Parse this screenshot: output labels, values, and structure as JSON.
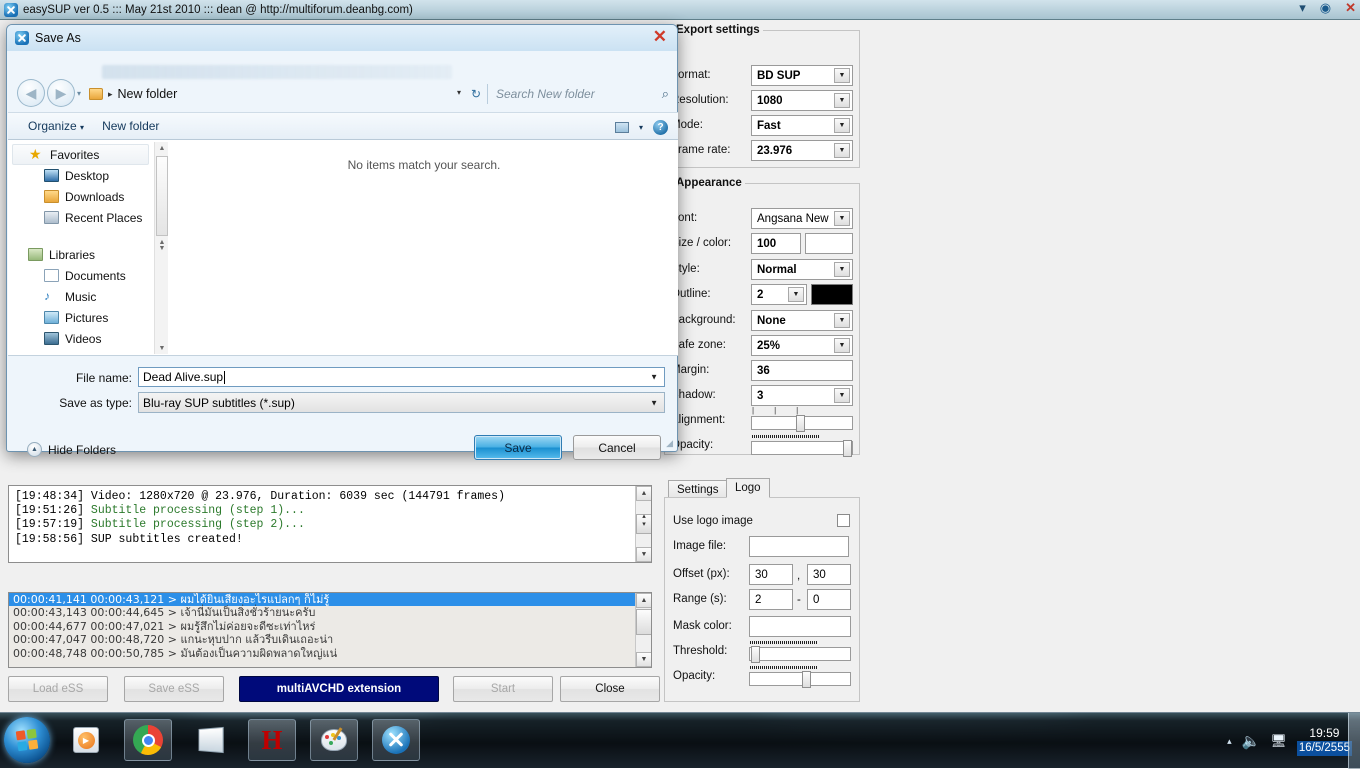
{
  "app": {
    "title": "easySUP ver 0.5 ::: May 21st 2010 ::: dean @ http://multiforum.deanbg.com)",
    "sysicon": "easysup-icon",
    "minimize": "▾",
    "maximize": "◉",
    "close": "✕"
  },
  "export_settings": {
    "group_title": "Export settings",
    "rows": [
      {
        "label": "Format:",
        "value": "BD SUP"
      },
      {
        "label": "Resolution:",
        "value": "1080"
      },
      {
        "label": "Mode:",
        "value": "Fast"
      },
      {
        "label": "Frame rate:",
        "value": "23.976"
      }
    ]
  },
  "appearance": {
    "group_title": "Appearance",
    "font_label": "Font:",
    "font_value": "Angsana New",
    "size_color_label": "Size / color:",
    "size_value": "100",
    "color_value": "",
    "style_label": "Style:",
    "style_value": "Normal",
    "outline_label": "Outline:",
    "outline_value": "2",
    "outline_color": "#000000",
    "background_label": "Background:",
    "background_value": "None",
    "safezone_label": "Safe zone:",
    "safezone_value": "25%",
    "margin_label": "Margin:",
    "margin_value": "36",
    "shadow_label": "Shadow:",
    "shadow_value": "3",
    "alignment_label": "Alignment:",
    "opacity_label": "Opacity:"
  },
  "tabs": [
    {
      "label": "Settings",
      "active": false
    },
    {
      "label": "Logo",
      "active": true
    }
  ],
  "logo_panel": {
    "use_logo_label": "Use logo image",
    "use_logo_checked": false,
    "image_file_label": "Image file:",
    "image_file_value": "",
    "offset_label": "Offset (px):",
    "offset_x": "30",
    "offset_sep": ",",
    "offset_y": "30",
    "range_label": "Range (s):",
    "range_from": "2",
    "range_sep": "-",
    "range_to": "0",
    "mask_color_label": "Mask color:",
    "mask_color_value": "",
    "threshold_label": "Threshold:",
    "opacity_label": "Opacity:"
  },
  "log": {
    "lines": [
      {
        "time": "[19:48:34] ",
        "text": "Video: 1280x720 @ 23.976, Duration: 6039 sec (144791 frames)",
        "green": false
      },
      {
        "time": "[19:51:26] ",
        "text": "Subtitle processing (step 1)...",
        "green": true
      },
      {
        "time": "[19:57:19] ",
        "text": "Subtitle processing (step 2)...",
        "green": true
      },
      {
        "time": "[19:58:56] ",
        "text": "SUP subtitles created!",
        "green": false
      }
    ]
  },
  "subtitles": {
    "rows": [
      {
        "text": "00:00:41,141 00:00:43,121 > ผมได้ยินเสียงอะไรแปลกๆ ก็ไม่รู้",
        "selected": true
      },
      {
        "text": "00:00:43,143 00:00:44,645 > เจ้านี่มันเป็นสิ่งชั่วร้ายนะครับ",
        "selected": false
      },
      {
        "text": "00:00:44,677 00:00:47,021 > ผมรู้สึกไม่ค่อยจะดีซะเท่าไหร่",
        "selected": false
      },
      {
        "text": "00:00:47,047 00:00:48,720 > แกนะหุบปาก แล้วรีบเดินเถอะน่า",
        "selected": false
      },
      {
        "text": "00:00:48,748 00:00:50,785 > มันต้องเป็นความผิดพลาดใหญ่แน่",
        "selected": false
      }
    ]
  },
  "bottom_buttons": [
    {
      "label": "Load eSS",
      "state": "disabled"
    },
    {
      "label": "Save eSS",
      "state": "disabled"
    },
    {
      "label": "multiAVCHD extension",
      "state": "accent"
    },
    {
      "label": "Start",
      "state": "disabled"
    },
    {
      "label": "Close",
      "state": "normal"
    }
  ],
  "save_dialog": {
    "title": "Save As",
    "close": "✕",
    "back_icon": "◀",
    "forward_icon": "▶",
    "breadcrumb_dropdown": "▾",
    "breadcrumb_sep": "▸",
    "breadcrumb_folder": "New folder",
    "refresh_icon": "↻",
    "search_placeholder": "Search New folder",
    "search_icon": "⌕",
    "toolbar": {
      "organize": "Organize",
      "organize_caret": "▾",
      "new_folder": "New folder",
      "view_caret": "▾",
      "help": "?"
    },
    "sidebar": [
      {
        "label": "Favorites",
        "icon": "star-icon",
        "level": "head",
        "selected": true
      },
      {
        "label": "Desktop",
        "icon": "desktop-icon",
        "level": "sub",
        "selected": false
      },
      {
        "label": "Downloads",
        "icon": "downloads-icon",
        "level": "sub",
        "selected": false
      },
      {
        "label": "Recent Places",
        "icon": "recent-places-icon",
        "level": "sub",
        "selected": false
      },
      {
        "label": "",
        "icon": "spacer",
        "level": "spacer",
        "selected": false
      },
      {
        "label": "Libraries",
        "icon": "libraries-icon",
        "level": "head",
        "selected": false
      },
      {
        "label": "Documents",
        "icon": "documents-icon",
        "level": "sub",
        "selected": false
      },
      {
        "label": "Music",
        "icon": "music-icon",
        "level": "sub",
        "selected": false
      },
      {
        "label": "Pictures",
        "icon": "pictures-icon",
        "level": "sub",
        "selected": false
      },
      {
        "label": "Videos",
        "icon": "videos-icon",
        "level": "sub",
        "selected": false
      }
    ],
    "empty_message": "No items match your search.",
    "file_name_label": "File name:",
    "file_name_value": "Dead Alive.sup",
    "save_as_type_label": "Save as type:",
    "save_as_type_value": "Blu-ray SUP subtitles (*.sup)",
    "hide_folders": "Hide Folders",
    "hide_folders_icon": "▲",
    "save_button": "Save",
    "cancel_button": "Cancel"
  },
  "taskbar": {
    "start": "start-orb",
    "items": [
      {
        "name": "windows-media-player",
        "framed": false
      },
      {
        "name": "google-chrome",
        "framed": true
      },
      {
        "name": "notepad-document",
        "framed": true
      },
      {
        "name": "red-h-app",
        "framed": true
      },
      {
        "name": "paint",
        "framed": true
      },
      {
        "name": "easysup",
        "framed": true
      }
    ],
    "tray": {
      "show_hidden": "▴",
      "volume_icon": "volume-icon",
      "network_icon": "network-icon",
      "time": "19:59",
      "date": "16/5/2555"
    }
  }
}
